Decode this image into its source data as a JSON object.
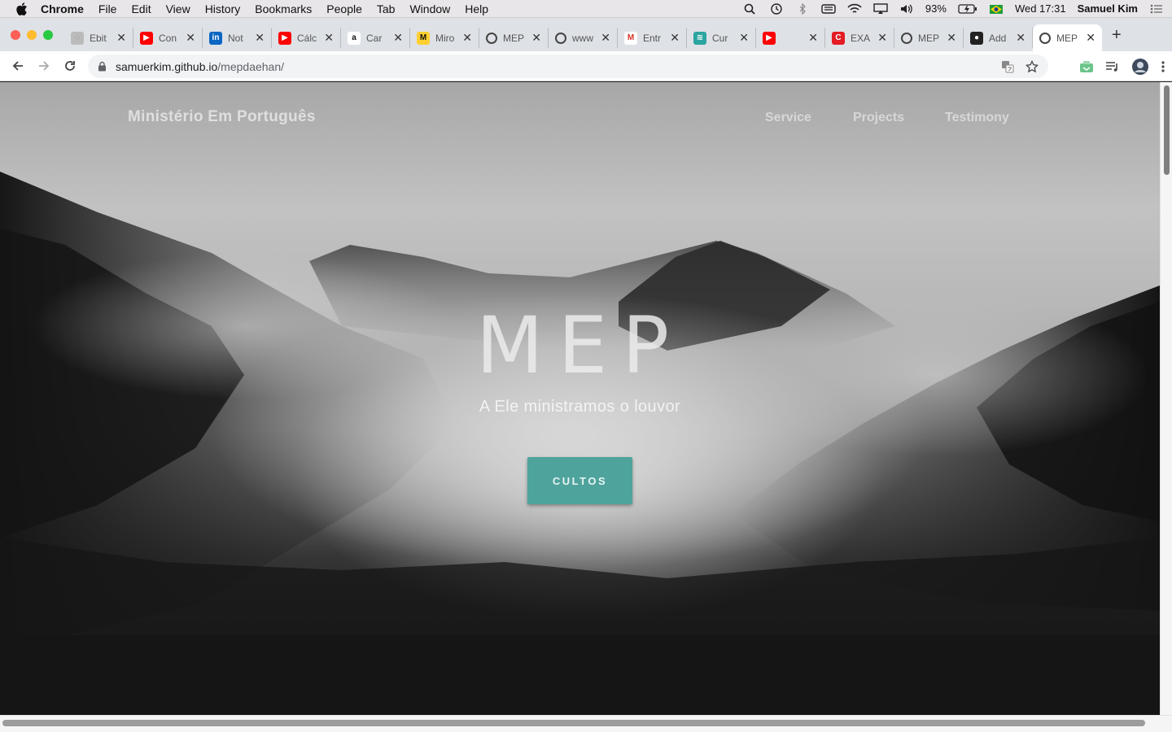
{
  "menubar": {
    "app": "Chrome",
    "items": [
      "File",
      "Edit",
      "View",
      "History",
      "Bookmarks",
      "People",
      "Tab",
      "Window",
      "Help"
    ],
    "battery": "93%",
    "clock": "Wed 17:31",
    "user": "Samuel Kim"
  },
  "tabs": [
    {
      "title": "Ebit",
      "icon": "loading-icon",
      "color": "#bbbbbb"
    },
    {
      "title": "Con",
      "icon": "youtube-icon",
      "color": "#ff0000"
    },
    {
      "title": "Not",
      "icon": "linkedin-icon",
      "color": "#0a66c2"
    },
    {
      "title": "Cálc",
      "icon": "youtube-icon",
      "color": "#ff0000"
    },
    {
      "title": "Car",
      "icon": "amazon-icon",
      "color": "#ffffff"
    },
    {
      "title": "Miro",
      "icon": "miro-icon",
      "color": "#ffd02f"
    },
    {
      "title": "MEP",
      "icon": "globe-icon",
      "color": "#444444"
    },
    {
      "title": "www",
      "icon": "globe-icon",
      "color": "#444444"
    },
    {
      "title": "Entr",
      "icon": "gmail-icon",
      "color": "#ffffff"
    },
    {
      "title": "Cur",
      "icon": "course-icon",
      "color": "#2aa5a0"
    },
    {
      "title": "",
      "icon": "youtube-audio-icon",
      "color": "#ff0000"
    },
    {
      "title": "EXA",
      "icon": "exam-icon",
      "color": "#e41b23"
    },
    {
      "title": "MEP",
      "icon": "globe-icon",
      "color": "#444444"
    },
    {
      "title": "Add",
      "icon": "github-icon",
      "color": "#222222"
    },
    {
      "title": "MEP",
      "icon": "globe-icon",
      "color": "#444444",
      "active": true
    }
  ],
  "address": {
    "host": "samuerkim.github.io",
    "path": "/mepdaehan/"
  },
  "site": {
    "brand": "Ministério Em Português",
    "nav": [
      "Service",
      "Projects",
      "Testimony"
    ],
    "title": "MEP",
    "subtitle": "A Ele ministramos o louvor",
    "cta": "CULTOS",
    "accent": "#4ea39c"
  }
}
